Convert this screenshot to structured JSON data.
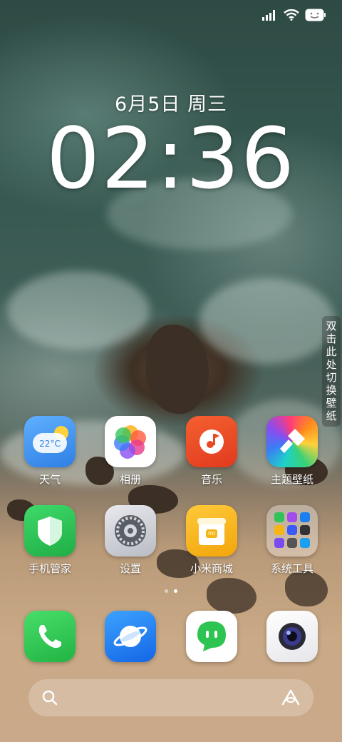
{
  "status_bar": {
    "icons": [
      "signal-icon",
      "wifi-icon",
      "battery-icon"
    ]
  },
  "lock": {
    "date": "6月5日 周三",
    "time": "02:36"
  },
  "wallpaper_switch": {
    "label": "双击此处切换壁纸"
  },
  "apps_row1": [
    {
      "label": "天气",
      "icon": "weather-icon",
      "temp": "22°C"
    },
    {
      "label": "相册",
      "icon": "gallery-icon"
    },
    {
      "label": "音乐",
      "icon": "music-icon"
    },
    {
      "label": "主题壁纸",
      "icon": "themes-icon"
    }
  ],
  "apps_row2": [
    {
      "label": "手机管家",
      "icon": "security-icon"
    },
    {
      "label": "设置",
      "icon": "settings-icon"
    },
    {
      "label": "小米商城",
      "icon": "mi-store-icon",
      "badge": "mi"
    },
    {
      "label": "系统工具",
      "icon": "folder-icon"
    }
  ],
  "page_indicator": {
    "pages": 2,
    "current": 2
  },
  "dock": [
    {
      "icon": "phone-icon"
    },
    {
      "icon": "browser-icon"
    },
    {
      "icon": "messages-icon"
    },
    {
      "icon": "camera-icon"
    }
  ],
  "search_bar": {
    "left_icon": "search-icon",
    "right_icon": "assistant-icon"
  },
  "colors": {
    "weather": "#3f8ee8",
    "music": "#e84a24",
    "security": "#2fc35a",
    "mi_store": "#f5b515",
    "phone": "#2ec452",
    "browser": "#1b7ff0"
  }
}
